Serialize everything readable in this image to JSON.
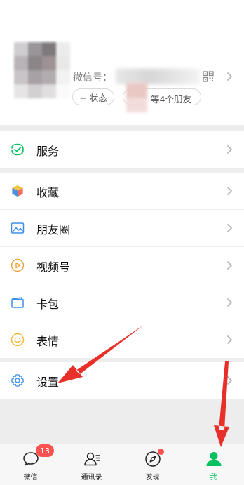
{
  "profile": {
    "wechat_id_label": "微信号：",
    "status_button": "+ 状态",
    "friends_text": "等4个朋友"
  },
  "menu": {
    "services": "服务",
    "favorites": "收藏",
    "moments": "朋友圈",
    "channels": "视频号",
    "cards": "卡包",
    "stickers": "表情",
    "settings": "设置"
  },
  "tabbar": {
    "chats": "微信",
    "chats_badge": "13",
    "contacts": "通讯录",
    "discover": "发现",
    "me": "我",
    "active_color": "#07c160"
  },
  "colors": {
    "accent_green": "#07c160",
    "badge_red": "#fa5151",
    "arrow_red": "#e8302a"
  }
}
